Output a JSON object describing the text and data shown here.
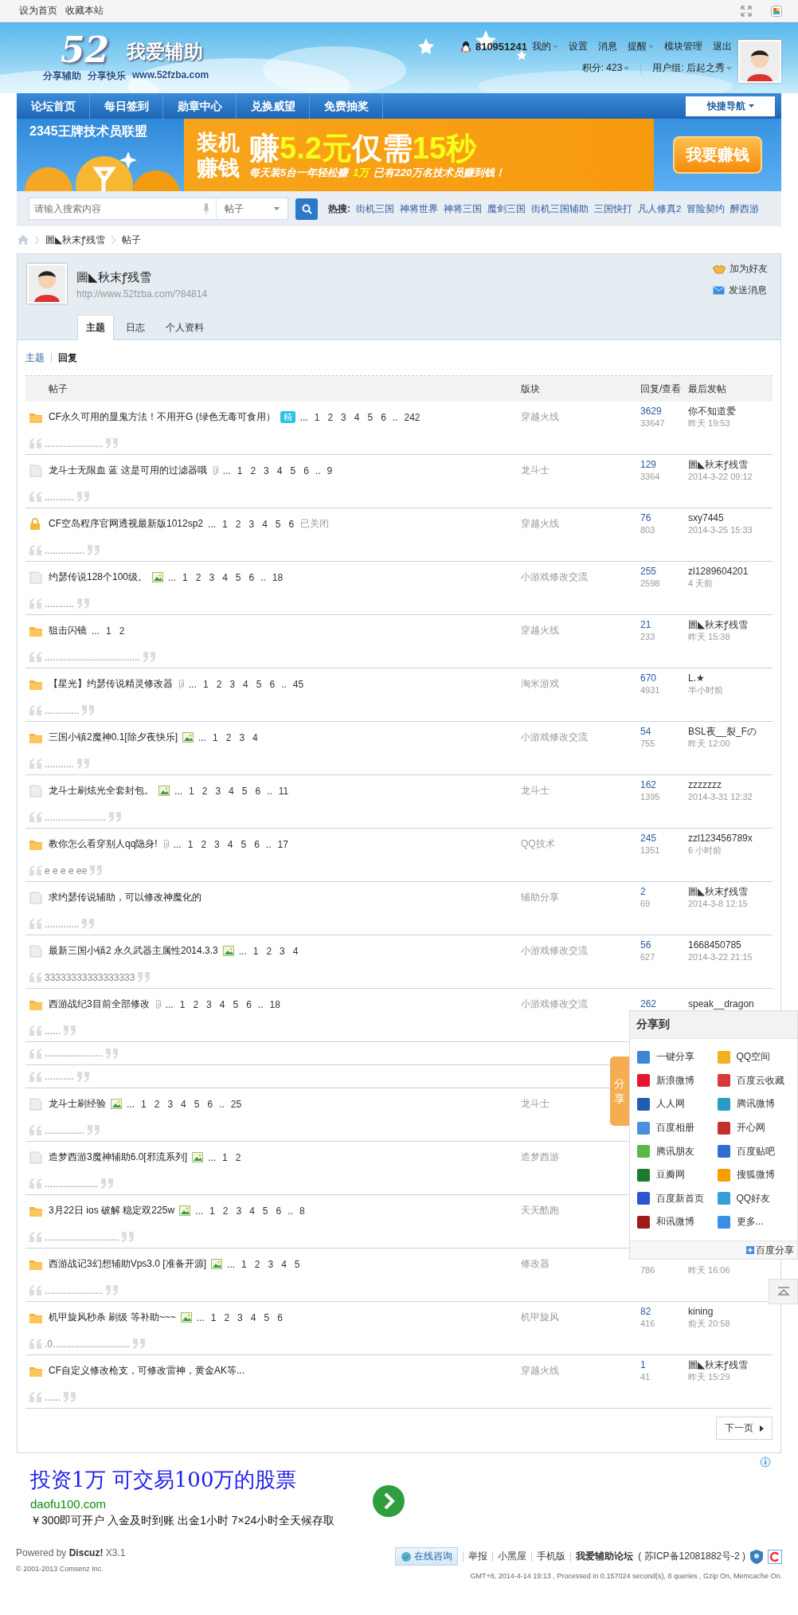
{
  "top_bar": {
    "links": [
      "设为首页",
      "收藏本站"
    ]
  },
  "header": {
    "logo_number": "52",
    "logo_title": "我爱辅助",
    "logo_slogan": [
      "分享辅助",
      "分享快乐",
      "www.52fzba.com"
    ],
    "qq": "810951241",
    "user_links": [
      {
        "label": "我的",
        "dropdown": true
      },
      {
        "label": "设置",
        "dropdown": false
      },
      {
        "label": "消息",
        "dropdown": false
      },
      {
        "label": "提醒",
        "dropdown": true
      },
      {
        "label": "模块管理",
        "dropdown": false
      },
      {
        "label": "退出",
        "dropdown": false
      }
    ],
    "points": "积分: 423",
    "usergroup": "用户组: 后起之秀"
  },
  "nav": {
    "items": [
      "论坛首页",
      "每日签到",
      "勋章中心",
      "兑换威望",
      "免费抽奖"
    ],
    "quick_nav": "快捷导航"
  },
  "banner": {
    "title": "2345王牌技术员联盟",
    "left_lines": [
      "装机",
      "赚钱"
    ],
    "headline": [
      {
        "text": "赚",
        "highlight": false
      },
      {
        "text": "5.2元",
        "highlight": true
      },
      {
        "text": "仅需",
        "highlight": false
      },
      {
        "text": "15秒",
        "highlight": true
      }
    ],
    "subline": [
      {
        "text": "每天装5台一年轻松赚",
        "highlight": false
      },
      {
        "text": "1万",
        "highlight": true
      },
      {
        "text": "已有220万名技术员赚到钱！",
        "highlight": false
      }
    ],
    "button": "我要赚钱"
  },
  "search": {
    "placeholder": "请输入搜索内容",
    "type": "帖子",
    "hot_label": "热搜:",
    "hot": [
      "街机三国",
      "神将世界",
      "神将三国",
      "魔剑三国",
      "街机三国辅助",
      "三国快打",
      "凡人修真2",
      "冒险契约",
      "醉西游"
    ]
  },
  "breadcrumb": [
    "圖◣秋末ꝭ残雪",
    "帖子"
  ],
  "profile": {
    "name": "圖◣秋末ꝭ残雪",
    "url": "http://www.52fzba.com/?84814",
    "actions": [
      "加为好友",
      "发送消息"
    ],
    "tabs": [
      {
        "label": "主题",
        "selected": true
      },
      {
        "label": "日志",
        "selected": false
      },
      {
        "label": "个人资料",
        "selected": false
      }
    ]
  },
  "subtabs": [
    {
      "label": "主题",
      "selected": false
    },
    {
      "label": "回复",
      "selected": true
    }
  ],
  "table": {
    "columns": [
      "帖子",
      "版块",
      "回复/查看",
      "最后发帖"
    ],
    "threads": [
      {
        "kind": "folder",
        "title": "CF永久可用的显鬼方法！不用开G (绿色无毒可食用）",
        "digest": "精",
        "lead": "...",
        "pages": [
          "1",
          "2",
          "3",
          "4",
          "5",
          "6"
        ],
        "gap": "..",
        "last_page": "242",
        "forum": "穿越火线",
        "replies": "3629",
        "views": "33647",
        "last_user": "你不知道爱",
        "last_time": "昨天 19:53",
        "quotes": [
          "......................"
        ]
      },
      {
        "kind": "page",
        "title": "龙斗士无限血 蓝 这是可用的过滤器哦",
        "attachment": true,
        "lead": "...",
        "pages": [
          "1",
          "2",
          "3",
          "4",
          "5",
          "6"
        ],
        "gap": "..",
        "last_page": "9",
        "forum": "龙斗士",
        "replies": "129",
        "views": "3364",
        "last_user": "圖◣秋末ꝭ残雪",
        "last_time": "2014-3-22 09:12",
        "quotes": [
          "..........."
        ]
      },
      {
        "kind": "lock",
        "title": "CF空岛程序官网透视最新版1012sp2",
        "lead": "...",
        "pages": [
          "1",
          "2",
          "3",
          "4",
          "5",
          "6"
        ],
        "closed": "已关闭",
        "forum": "穿越火线",
        "replies": "76",
        "views": "803",
        "last_user": "sxy7445",
        "last_time": "2014-3-25 15:33",
        "quotes": [
          "..............."
        ]
      },
      {
        "kind": "page",
        "title": "约瑟传说128个100级。",
        "image": true,
        "lead": "...",
        "pages": [
          "1",
          "2",
          "3",
          "4",
          "5",
          "6"
        ],
        "gap": "..",
        "last_page": "18",
        "forum": "小游戏修改交流",
        "replies": "255",
        "views": "2598",
        "last_user": "zl1289604201",
        "last_time": "4 天前",
        "quotes": [
          "..........."
        ]
      },
      {
        "kind": "folder",
        "title": "狙击闪镜",
        "lead": "...",
        "pages": [
          "1",
          "2"
        ],
        "forum": "穿越火线",
        "replies": "21",
        "views": "233",
        "last_user": "圖◣秋末ꝭ残雪",
        "last_time": "昨天 15:38",
        "quotes": [
          "...................................."
        ]
      },
      {
        "kind": "folder",
        "title": "【星光】约瑟传说精灵修改器",
        "attachment": true,
        "lead": "...",
        "pages": [
          "1",
          "2",
          "3",
          "4",
          "5",
          "6"
        ],
        "gap": "..",
        "last_page": "45",
        "forum": "淘米游戏",
        "replies": "670",
        "views": "4931",
        "last_user": "L.★",
        "last_time": "半小时前",
        "quotes": [
          "............."
        ]
      },
      {
        "kind": "folder",
        "title": "三国小镇2魔神0.1[除夕夜快乐]",
        "image": true,
        "lead": "...",
        "pages": [
          "1",
          "2",
          "3",
          "4"
        ],
        "forum": "小游戏修改交流",
        "replies": "54",
        "views": "755",
        "last_user": "BSL夜__裂_Fの",
        "last_time": "昨天 12:00",
        "quotes": [
          "..........."
        ]
      },
      {
        "kind": "page",
        "title": "龙斗士刷炫光全套封包。",
        "image": true,
        "lead": "...",
        "pages": [
          "1",
          "2",
          "3",
          "4",
          "5",
          "6"
        ],
        "gap": "..",
        "last_page": "11",
        "forum": "龙斗士",
        "replies": "162",
        "views": "1395",
        "last_user": "zzzzzzz",
        "last_time": "2014-3-31 12:32",
        "quotes": [
          "......................."
        ]
      },
      {
        "kind": "folder",
        "title": "教你怎么看穿别人qq隐身!",
        "attachment": true,
        "lead": "...",
        "pages": [
          "1",
          "2",
          "3",
          "4",
          "5",
          "6"
        ],
        "gap": "..",
        "last_page": "17",
        "forum": "QQ技术",
        "replies": "245",
        "views": "1351",
        "last_user": "zzl123456789x",
        "last_time": "6 小时前",
        "quotes": [
          "e e e e ee"
        ]
      },
      {
        "kind": "page",
        "title": "求约瑟传说辅助，可以修改神魔化的",
        "forum": "辅助分享",
        "replies": "2",
        "views": "69",
        "last_user": "圖◣秋末ꝭ残雪",
        "last_time": "2014-3-8 12:15",
        "quotes": [
          "............."
        ]
      },
      {
        "kind": "page",
        "title": "最新三国小镇2 永久武器主属性2014.3.3",
        "image": true,
        "lead": "...",
        "pages": [
          "1",
          "2",
          "3",
          "4"
        ],
        "forum": "小游戏修改交流",
        "replies": "56",
        "views": "627",
        "last_user": "1668450785",
        "last_time": "2014-3-22 21:15",
        "quotes": [
          "33333333333333333"
        ]
      },
      {
        "kind": "folder",
        "title": "西游战纪3目前全部修改",
        "attachment": true,
        "lead": "...",
        "pages": [
          "1",
          "2",
          "3",
          "4",
          "5",
          "6"
        ],
        "gap": "..",
        "last_page": "18",
        "forum": "小游戏修改交流",
        "replies": "262",
        "last_user": "speak__dragon",
        "quotes": [
          "......",
          "......................",
          "..........."
        ]
      },
      {
        "kind": "page",
        "title": "龙斗士刷经验",
        "image": true,
        "lead": "...",
        "pages": [
          "1",
          "2",
          "3",
          "4",
          "5",
          "6"
        ],
        "gap": "..",
        "last_page": "25",
        "forum": "龙斗士",
        "quotes": [
          "..............."
        ]
      },
      {
        "kind": "page",
        "title": "造梦西游3魔神辅助6.0[邪流系列]",
        "image": true,
        "lead": "...",
        "pages": [
          "1",
          "2"
        ],
        "forum": "造梦西游",
        "quotes": [
          "...................."
        ]
      },
      {
        "kind": "folder",
        "title": "3月22日 ios 破解 稳定双225w",
        "image": true,
        "lead": "...",
        "pages": [
          "1",
          "2",
          "3",
          "4",
          "5",
          "6"
        ],
        "gap": "..",
        "last_page": "8",
        "forum": "天天酷跑",
        "quotes": [
          "............................"
        ]
      },
      {
        "kind": "folder",
        "title": "西游战记3幻想辅助Vps3.0 [准备开源]",
        "image": true,
        "lead": "...",
        "pages": [
          "1",
          "2",
          "3",
          "4",
          "5"
        ],
        "forum": "修改器",
        "views": "786",
        "last_time": "昨天 16:06",
        "quotes": [
          "......................"
        ]
      },
      {
        "kind": "folder",
        "title": "机甲旋风秒杀 刷级 等补助~~~",
        "image": true,
        "lead": "...",
        "pages": [
          "1",
          "2",
          "3",
          "4",
          "5",
          "6"
        ],
        "forum": "机甲旋风",
        "replies": "82",
        "views": "416",
        "last_user": "kining",
        "last_time": "前天 20:58",
        "quotes": [
          ".0............................."
        ]
      },
      {
        "kind": "folder",
        "title": "CF自定义修改枪支，可修改雷神，黄金AK等...",
        "forum": "穿越火线",
        "replies": "1",
        "views": "41",
        "last_user": "圖◣秋末ꝭ残雪",
        "last_time": "昨天 15:29",
        "quotes": [
          "......"
        ]
      }
    ]
  },
  "pagination": {
    "next": "下一页"
  },
  "ad": {
    "title": "投资1万 可交易100万的股票",
    "domain": "daofu100.com",
    "description": "￥300即可开户 入金及时到账 出金1小时 7×24小时全天候存取"
  },
  "footer": {
    "powered": "Powered by **Discuz!** X3.1",
    "copyright": "© 2001-2013 Comsenz Inc.",
    "consult": "在线咨询",
    "links": [
      "举报",
      "小黑屋",
      "手机版"
    ],
    "site": "我爱辅助论坛",
    "icp": "( 苏ICP备12081882号-2 )",
    "stats": "GMT+8, 2014-4-14 19:13 , Processed in 0.157024 second(s), 8 queries , Gzip On, Memcache On."
  },
  "share": {
    "tab": "分享",
    "title": "分享到",
    "footer": "百度分享",
    "items": [
      {
        "label": "一键分享",
        "color": "#3d86d6"
      },
      {
        "label": "QQ空间",
        "color": "#f2b01e"
      },
      {
        "label": "新浪微博",
        "color": "#e6162d"
      },
      {
        "label": "百度云收藏",
        "color": "#d8383a"
      },
      {
        "label": "人人网",
        "color": "#1f5fb0"
      },
      {
        "label": "腾讯微博",
        "color": "#2a9bc4"
      },
      {
        "label": "百度相册",
        "color": "#4a8fe0"
      },
      {
        "label": "开心网",
        "color": "#c4302b"
      },
      {
        "label": "腾讯朋友",
        "color": "#58b947"
      },
      {
        "label": "百度贴吧",
        "color": "#2f6fd1"
      },
      {
        "label": "豆瓣网",
        "color": "#1d7a31"
      },
      {
        "label": "搜狐微博",
        "color": "#f5a000"
      },
      {
        "label": "百度新首页",
        "color": "#2b54d3"
      },
      {
        "label": "QQ好友",
        "color": "#35a0d8"
      },
      {
        "label": "和讯微博",
        "color": "#9e1b1b"
      },
      {
        "label": "更多...",
        "color": "#3a8ee6"
      }
    ]
  }
}
